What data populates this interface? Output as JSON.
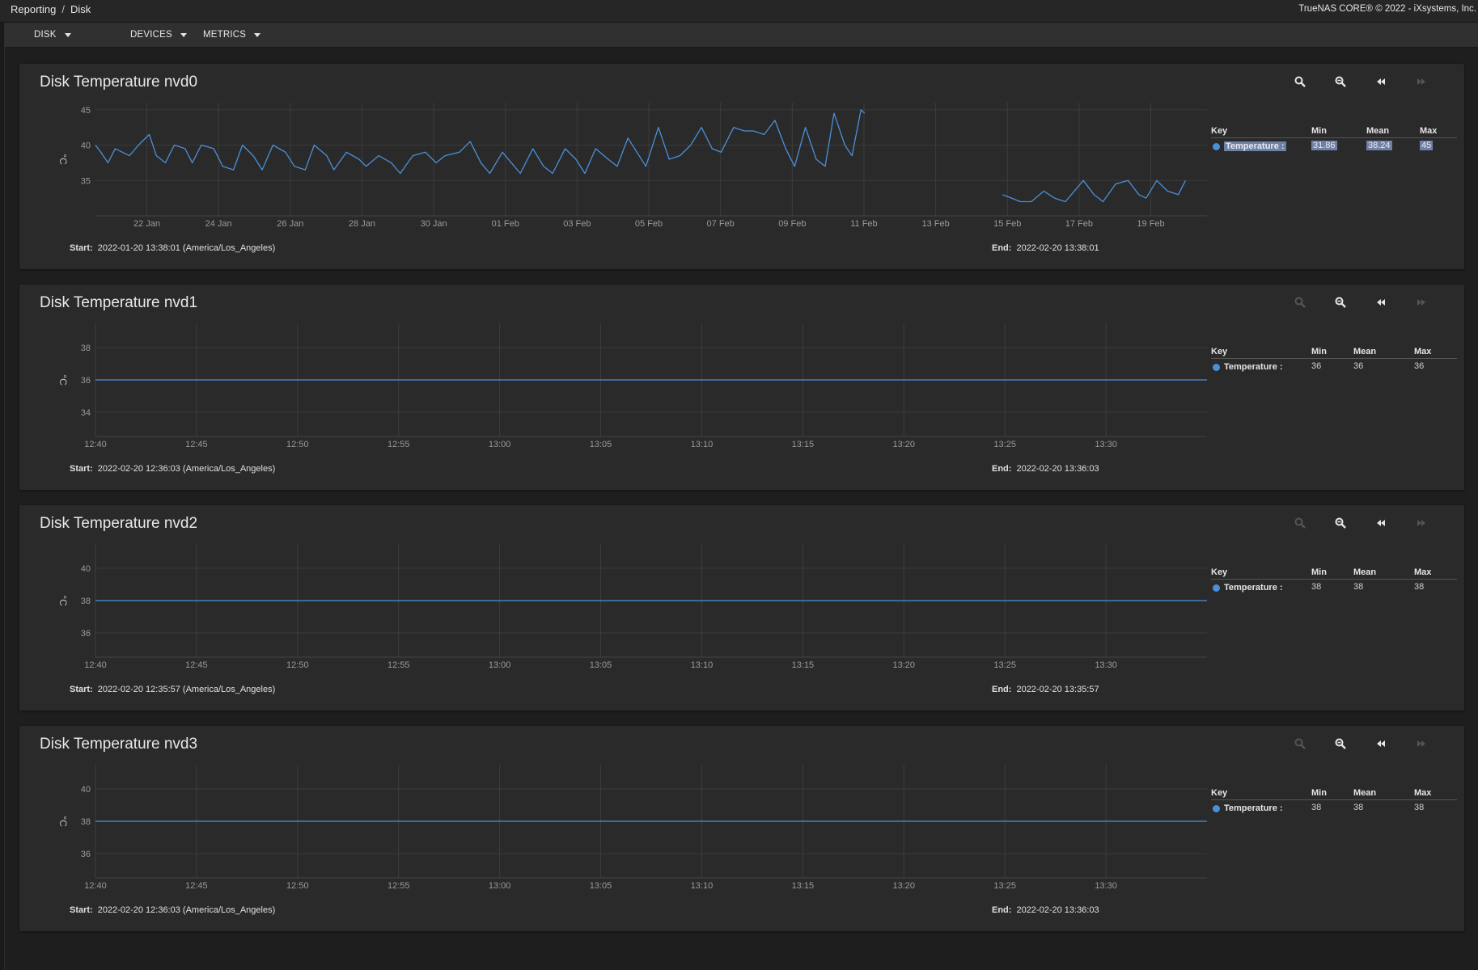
{
  "breadcrumb": {
    "parent": "Reporting",
    "separator": "/",
    "current": "Disk"
  },
  "copyright": "TrueNAS CORE® © 2022 - iXsystems, Inc.",
  "toolbar": {
    "disk_label": "DISK",
    "devices_label": "DEVICES",
    "metrics_label": "METRICS"
  },
  "icons": {
    "zoom_in": "zoom-in-icon",
    "zoom_out": "zoom-out-icon",
    "step_back": "step-back-icon",
    "step_forward": "step-forward-icon"
  },
  "colors": {
    "series": "#4a90d9",
    "background": "#1e1e1e",
    "card": "#2a2a2a",
    "highlight": "#6f80a6"
  },
  "legend_header": {
    "key": "Key",
    "min": "Min",
    "mean": "Mean",
    "max": "Max"
  },
  "start_label": "Start:",
  "end_label": "End:",
  "cards": [
    {
      "title": "Disk Temperature nvd0",
      "start": "2022-01-20 13:38:01 (America/Los_Angeles)",
      "end": "2022-02-20 13:38:01",
      "legend": {
        "name": "Temperature :",
        "min": "31.86",
        "mean": "38.24",
        "max": "45"
      }
    },
    {
      "title": "Disk Temperature nvd1",
      "start": "2022-02-20 12:36:03 (America/Los_Angeles)",
      "end": "2022-02-20 13:36:03",
      "legend": {
        "name": "Temperature :",
        "min": "36",
        "mean": "36",
        "max": "36"
      }
    },
    {
      "title": "Disk Temperature nvd2",
      "start": "2022-02-20 12:35:57 (America/Los_Angeles)",
      "end": "2022-02-20 13:35:57",
      "legend": {
        "name": "Temperature :",
        "min": "38",
        "mean": "38",
        "max": "38"
      }
    },
    {
      "title": "Disk Temperature nvd3",
      "start": "2022-02-20 12:36:03 (America/Los_Angeles)",
      "end": "2022-02-20 13:36:03",
      "legend": {
        "name": "Temperature :",
        "min": "38",
        "mean": "38",
        "max": "38"
      }
    }
  ],
  "chart_data": [
    {
      "type": "line",
      "title": "Disk Temperature nvd0",
      "ylabel": "°C",
      "ylim": [
        30,
        46
      ],
      "yticks": [
        35,
        40,
        45
      ],
      "xlim": [
        "2022-01-20 13:38",
        "2022-02-20 13:38"
      ],
      "xticks": [
        "22 Jan",
        "24 Jan",
        "26 Jan",
        "28 Jan",
        "30 Jan",
        "01 Feb",
        "03 Feb",
        "05 Feb",
        "07 Feb",
        "09 Feb",
        "11 Feb",
        "13 Feb",
        "15 Feb",
        "17 Feb",
        "19 Feb"
      ],
      "grid": true,
      "series": [
        {
          "name": "Temperature",
          "values": [
            [
              0.0,
              40.0
            ],
            [
              0.15,
              39.0
            ],
            [
              0.35,
              37.5
            ],
            [
              0.55,
              39.5
            ],
            [
              0.75,
              39.0
            ],
            [
              0.95,
              38.5
            ],
            [
              1.2,
              40.0
            ],
            [
              1.5,
              41.5
            ],
            [
              1.7,
              38.5
            ],
            [
              1.95,
              37.5
            ],
            [
              2.2,
              40.0
            ],
            [
              2.5,
              39.5
            ],
            [
              2.7,
              37.5
            ],
            [
              2.95,
              40.0
            ],
            [
              3.3,
              39.5
            ],
            [
              3.55,
              37.0
            ],
            [
              3.85,
              36.5
            ],
            [
              4.1,
              40.0
            ],
            [
              4.4,
              38.5
            ],
            [
              4.65,
              36.5
            ],
            [
              4.95,
              40.0
            ],
            [
              5.3,
              39.0
            ],
            [
              5.55,
              37.0
            ],
            [
              5.85,
              36.5
            ],
            [
              6.1,
              40.0
            ],
            [
              6.45,
              38.5
            ],
            [
              6.65,
              36.5
            ],
            [
              7.0,
              39.0
            ],
            [
              7.35,
              38.0
            ],
            [
              7.55,
              37.0
            ],
            [
              7.9,
              38.5
            ],
            [
              8.25,
              37.5
            ],
            [
              8.5,
              36.0
            ],
            [
              8.85,
              38.5
            ],
            [
              9.2,
              39.0
            ],
            [
              9.5,
              37.5
            ],
            [
              9.75,
              38.5
            ],
            [
              10.15,
              39.0
            ],
            [
              10.45,
              40.5
            ],
            [
              10.75,
              37.5
            ],
            [
              11.0,
              36.0
            ],
            [
              11.35,
              39.0
            ],
            [
              11.6,
              37.5
            ],
            [
              11.85,
              36.0
            ],
            [
              12.2,
              39.5
            ],
            [
              12.5,
              37.0
            ],
            [
              12.75,
              36.0
            ],
            [
              13.1,
              39.5
            ],
            [
              13.4,
              38.0
            ],
            [
              13.65,
              36.0
            ],
            [
              13.95,
              39.5
            ],
            [
              14.3,
              38.0
            ],
            [
              14.55,
              37.0
            ],
            [
              14.85,
              41.0
            ],
            [
              15.1,
              39.0
            ],
            [
              15.35,
              37.0
            ],
            [
              15.7,
              42.5
            ],
            [
              16.0,
              38.0
            ],
            [
              16.3,
              38.5
            ],
            [
              16.6,
              40.0
            ],
            [
              16.9,
              42.5
            ],
            [
              17.2,
              39.5
            ],
            [
              17.45,
              39.0
            ],
            [
              17.8,
              42.5
            ],
            [
              18.1,
              42.0
            ],
            [
              18.35,
              42.0
            ],
            [
              18.65,
              41.5
            ],
            [
              18.95,
              43.5
            ],
            [
              19.25,
              39.5
            ],
            [
              19.5,
              37.0
            ],
            [
              19.8,
              42.5
            ],
            [
              20.1,
              38.0
            ],
            [
              20.35,
              37.0
            ],
            [
              20.6,
              44.5
            ],
            [
              20.9,
              40.0
            ],
            [
              21.1,
              38.5
            ],
            [
              21.35,
              45.0
            ],
            [
              21.45,
              44.5
            ]
          ]
        },
        {
          "name": "Temperature",
          "values": [
            [
              25.3,
              33.0
            ],
            [
              25.55,
              32.5
            ],
            [
              25.8,
              32.0
            ],
            [
              26.1,
              32.0
            ],
            [
              26.45,
              33.5
            ],
            [
              26.75,
              32.5
            ],
            [
              27.05,
              32.0
            ],
            [
              27.3,
              33.5
            ],
            [
              27.55,
              35.0
            ],
            [
              27.85,
              33.0
            ],
            [
              28.1,
              32.0
            ],
            [
              28.45,
              34.5
            ],
            [
              28.8,
              35.0
            ],
            [
              29.1,
              33.0
            ],
            [
              29.3,
              32.5
            ],
            [
              29.6,
              35.0
            ],
            [
              29.9,
              33.5
            ],
            [
              30.2,
              33.0
            ],
            [
              30.4,
              35.0
            ]
          ]
        }
      ]
    },
    {
      "type": "line",
      "title": "Disk Temperature nvd1",
      "ylabel": "°C",
      "ylim": [
        32.5,
        39.5
      ],
      "yticks": [
        34,
        36,
        38
      ],
      "xlim": [
        "12:40",
        "13:35"
      ],
      "xticks": [
        "12:40",
        "12:45",
        "12:50",
        "12:55",
        "13:00",
        "13:05",
        "13:10",
        "13:15",
        "13:20",
        "13:25",
        "13:30"
      ],
      "grid": true,
      "series": [
        {
          "name": "Temperature",
          "values": [
            [
              "12:40",
              36
            ],
            [
              "13:35",
              36
            ]
          ]
        }
      ]
    },
    {
      "type": "line",
      "title": "Disk Temperature nvd2",
      "ylabel": "°C",
      "ylim": [
        34.5,
        41.5
      ],
      "yticks": [
        36,
        38,
        40
      ],
      "xlim": [
        "12:40",
        "13:35"
      ],
      "xticks": [
        "12:40",
        "12:45",
        "12:50",
        "12:55",
        "13:00",
        "13:05",
        "13:10",
        "13:15",
        "13:20",
        "13:25",
        "13:30"
      ],
      "grid": true,
      "series": [
        {
          "name": "Temperature",
          "values": [
            [
              "12:40",
              38
            ],
            [
              "13:35",
              38
            ]
          ]
        }
      ]
    },
    {
      "type": "line",
      "title": "Disk Temperature nvd3",
      "ylabel": "°C",
      "ylim": [
        34.5,
        41.5
      ],
      "yticks": [
        36,
        38,
        40
      ],
      "xlim": [
        "12:40",
        "13:35"
      ],
      "xticks": [
        "12:40",
        "12:45",
        "12:50",
        "12:55",
        "13:00",
        "13:05",
        "13:10",
        "13:15",
        "13:20",
        "13:25",
        "13:30"
      ],
      "grid": true,
      "series": [
        {
          "name": "Temperature",
          "values": [
            [
              "12:40",
              38
            ],
            [
              "13:35",
              38
            ]
          ]
        }
      ]
    }
  ]
}
